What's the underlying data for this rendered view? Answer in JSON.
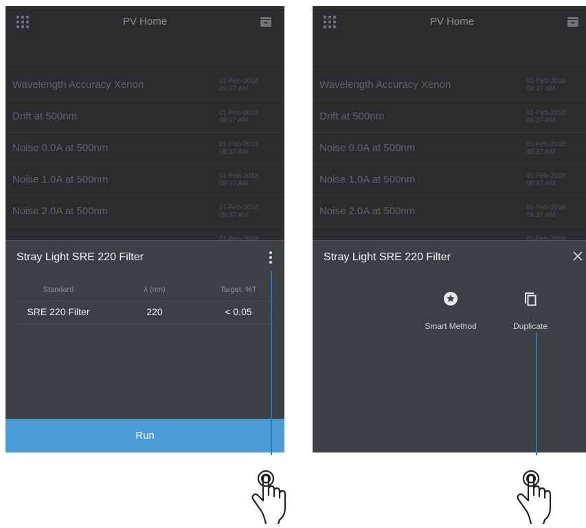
{
  "screens": [
    {
      "topbar": {
        "title": "PV Home",
        "left_icon": "grid-icon",
        "right_icon": "archive-icon"
      },
      "list": [
        {
          "name": "Wavelength Accuracy Xenon",
          "date": "01-Feb-2018",
          "time": "08:37 AM"
        },
        {
          "name": "Drift at 500nm",
          "date": "01-Feb-2018",
          "time": "08:37 AM"
        },
        {
          "name": "Noise 0.0A at 500nm",
          "date": "01-Feb-2018",
          "time": "08:37 AM"
        },
        {
          "name": "Noise 1.0A at 500nm",
          "date": "01-Feb-2018",
          "time": "08:37 AM"
        },
        {
          "name": "Noise 2.0A at 500nm",
          "date": "01-Feb-2018",
          "time": "08:37 AM"
        },
        {
          "name": "",
          "date": "01-Feb-2018",
          "time": ""
        }
      ],
      "sheet": {
        "title": "Stray Light SRE 220 Filter",
        "menu_icon": "more-vertical-icon",
        "table": {
          "headers": [
            "Standard",
            "λ (nm)",
            "Target: %T"
          ],
          "rows": [
            [
              "SRE 220 Filter",
              "220",
              "< 0.05"
            ]
          ]
        },
        "run_label": "Run"
      }
    },
    {
      "topbar": {
        "title": "PV Home",
        "left_icon": "grid-icon",
        "right_icon": "archive-icon"
      },
      "list": [
        {
          "name": "Wavelength Accuracy Xenon",
          "date": "01-Feb-2018",
          "time": "08:37 AM"
        },
        {
          "name": "Drift at 500nm",
          "date": "01-Feb-2018",
          "time": "08:37 AM"
        },
        {
          "name": "Noise 0.0A at 500nm",
          "date": "01-Feb-2018",
          "time": "08:37 AM"
        },
        {
          "name": "Noise 1.0A at 500nm",
          "date": "01-Feb-2018",
          "time": "08:37 AM"
        },
        {
          "name": "Noise 2.0A at 500nm",
          "date": "01-Feb-2018",
          "time": "08:37 AM"
        },
        {
          "name": "",
          "date": "01-Feb-2018",
          "time": ""
        }
      ],
      "sheet": {
        "title": "Stray Light SRE 220 Filter",
        "close_icon": "close-icon",
        "actions": [
          {
            "label": "Smart Method",
            "icon": "star-badge-icon"
          },
          {
            "label": "Duplicate",
            "icon": "duplicate-icon"
          }
        ]
      }
    }
  ],
  "colors": {
    "background": "#2b2c2e",
    "sheet": "#3c3f43",
    "accent": "#4a9bd6",
    "pointer_line": "#2a78b8"
  }
}
